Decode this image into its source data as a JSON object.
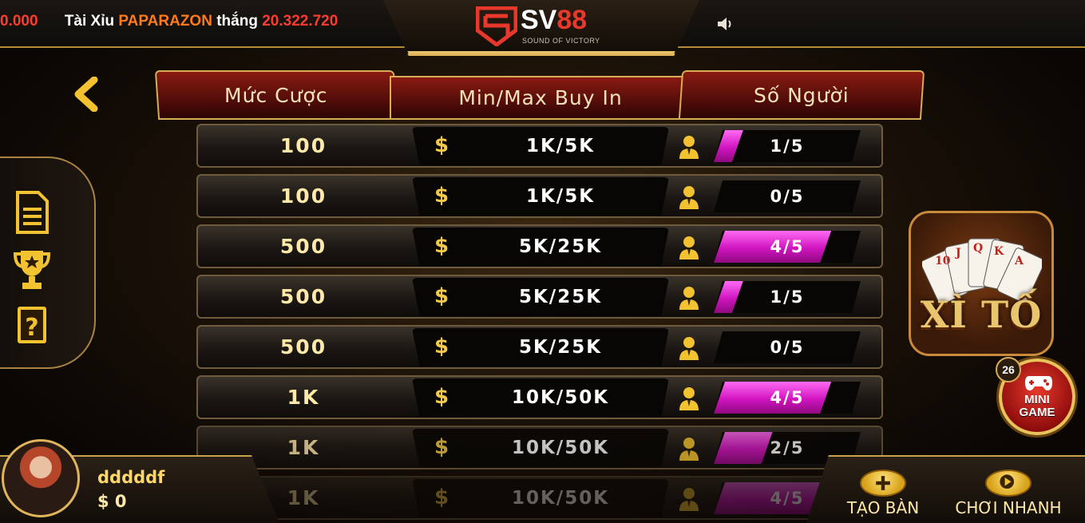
{
  "ticker": {
    "amount_prefix": "0.000",
    "game": "Tài Xỉu",
    "player": "PAPARAZON",
    "verb": "thắng",
    "win_amount": "20.322.720"
  },
  "logo": {
    "brand_s": "SV",
    "brand_n": "88",
    "tagline": "SOUND OF VICTORY"
  },
  "headers": {
    "bet": "Mức Cược",
    "buyin": "Min/Max Buy In",
    "players": "Số Người"
  },
  "currency_symbol": "$",
  "rooms": [
    {
      "bet": "100",
      "buyin": "1K/5K",
      "players": "1/5",
      "fill": 0.2
    },
    {
      "bet": "100",
      "buyin": "1K/5K",
      "players": "0/5",
      "fill": 0.0
    },
    {
      "bet": "500",
      "buyin": "5K/25K",
      "players": "4/5",
      "fill": 0.8
    },
    {
      "bet": "500",
      "buyin": "5K/25K",
      "players": "1/5",
      "fill": 0.2
    },
    {
      "bet": "500",
      "buyin": "5K/25K",
      "players": "0/5",
      "fill": 0.0
    },
    {
      "bet": "1K",
      "buyin": "10K/50K",
      "players": "4/5",
      "fill": 0.8
    },
    {
      "bet": "1K",
      "buyin": "10K/50K",
      "players": "2/5",
      "fill": 0.4
    },
    {
      "bet": "1K",
      "buyin": "10K/50K",
      "players": "4/5",
      "fill": 0.8
    }
  ],
  "game_card": {
    "title": "XÌ TỐ"
  },
  "minigame": {
    "label_line1": "MINI",
    "label_line2": "GAME",
    "badge": "26"
  },
  "user": {
    "name": "dddddf",
    "balance": "$ 0"
  },
  "actions": {
    "create_table": "TẠO BÀN",
    "quick_play": "CHƠI NHANH"
  },
  "colors": {
    "accent_gold": "#e0b55a",
    "fill_magenta": "#d014bf",
    "ticker_red": "#ff3b30",
    "ticker_orange": "#ff7a1a"
  }
}
